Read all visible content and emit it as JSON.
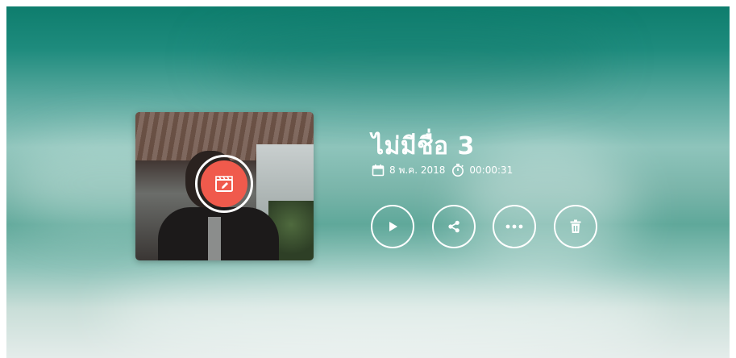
{
  "project": {
    "title": "ไม่มีชื่อ 3",
    "date": "8 พ.ค. 2018",
    "duration": "00:00:31"
  },
  "icons": {
    "thumbnail_overlay": "edit-clapperboard-icon",
    "date": "calendar-icon",
    "duration": "stopwatch-icon",
    "play": "play-icon",
    "share": "share-icon",
    "more": "more-horizontal-icon",
    "delete": "trash-icon"
  },
  "colors": {
    "accent": "#f05a4c",
    "text": "#ffffff",
    "background_top": "#0e7d6d"
  }
}
